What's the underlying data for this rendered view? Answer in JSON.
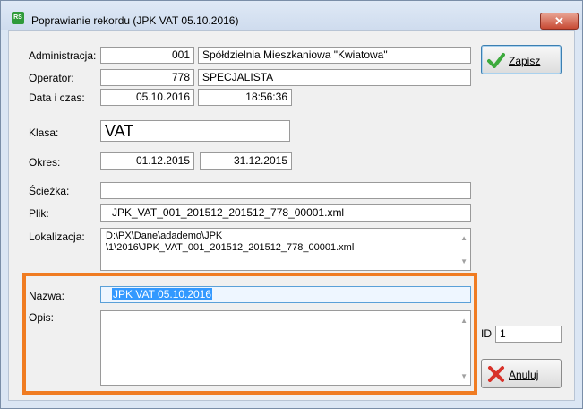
{
  "window": {
    "icon_text": "RS",
    "title": "Poprawianie rekordu  (JPK VAT 05.10.2016)",
    "close_glyph": "✕"
  },
  "form": {
    "administracja": {
      "label": "Administracja:",
      "code": "001",
      "name": "Spółdzielnia Mieszkaniowa \"Kwiatowa\""
    },
    "operator": {
      "label": "Operator:",
      "code": "778",
      "name": "SPECJALISTA"
    },
    "data_czas": {
      "label": "Data i czas:",
      "date": "05.10.2016",
      "time": "18:56:36"
    },
    "klasa": {
      "label": "Klasa:",
      "value": "VAT"
    },
    "okres": {
      "label": "Okres:",
      "from": "01.12.2015",
      "to": "31.12.2015"
    },
    "sciezka": {
      "label": "Ścieżka:",
      "value": ""
    },
    "plik": {
      "label": "Plik:",
      "value": "JPK_VAT_001_201512_201512_778_00001.xml"
    },
    "lokalizacja": {
      "label": "Lokalizacja:",
      "line1": "D:\\PX\\Dane\\adademo\\JPK",
      "line2": "\\1\\2016\\JPK_VAT_001_201512_201512_778_00001.xml"
    },
    "nazwa": {
      "label": "Nazwa:",
      "value": "JPK VAT 05.10.2016"
    },
    "opis": {
      "label": "Opis:",
      "value": ""
    },
    "id": {
      "label": "ID",
      "value": "1"
    }
  },
  "buttons": {
    "save": "Zapisz",
    "cancel": "Anuluj"
  },
  "colors": {
    "highlight": "#f07c22",
    "selection": "#3399ff",
    "check_icon": "#3caa3c",
    "cancel_icon": "#d8322a"
  }
}
